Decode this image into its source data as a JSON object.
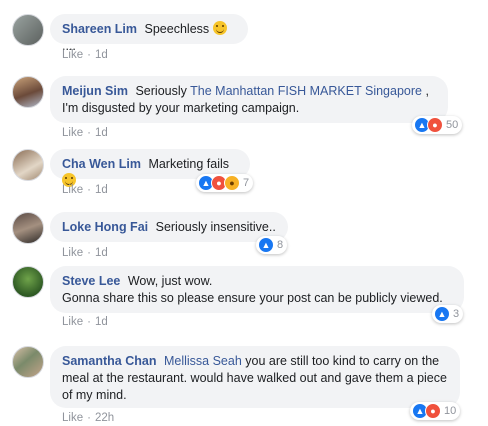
{
  "meta_labels": {
    "like": "Like",
    "separator": "·"
  },
  "comments": [
    {
      "name": "Shareen Lim",
      "text": "Speechless",
      "tail": "....",
      "time": "1d"
    },
    {
      "name": "Meijun Sim",
      "text_before": "Seriously",
      "mention": "The Manhattan FISH MARKET Singapore",
      "text_after": ", I'm disgusted by your marketing campaign.",
      "time": "1d",
      "reaction_count": "50"
    },
    {
      "name": "Cha Wen Lim",
      "text": "Marketing fails",
      "time": "1d",
      "reaction_count": "7"
    },
    {
      "name": "Loke Hong Fai",
      "text": "Seriously insensitive..",
      "time": "1d",
      "reaction_count": "8"
    },
    {
      "name": "Steve Lee",
      "text": "Wow, just wow.",
      "line2": "Gonna share this so please ensure your post can be publicly viewed.",
      "time": "1d",
      "reaction_count": "3"
    },
    {
      "name": "Samantha Chan",
      "mention": "Mellissa Seah",
      "text": "you are still too kind to carry on the meal at the restaurant. would have walked out and gave them a piece of my mind.",
      "time": "22h",
      "reaction_count": "10"
    }
  ],
  "icons": {
    "like": "thumbs-up-icon",
    "angry": "angry-face-icon",
    "haha": "laughing-face-icon",
    "smile": "smiling-face-emoji"
  },
  "colors": {
    "name": "#385898",
    "bubble": "#f2f3f5",
    "meta": "#90949c",
    "like_blue": "#1877f2",
    "angry": "#f0513d"
  }
}
